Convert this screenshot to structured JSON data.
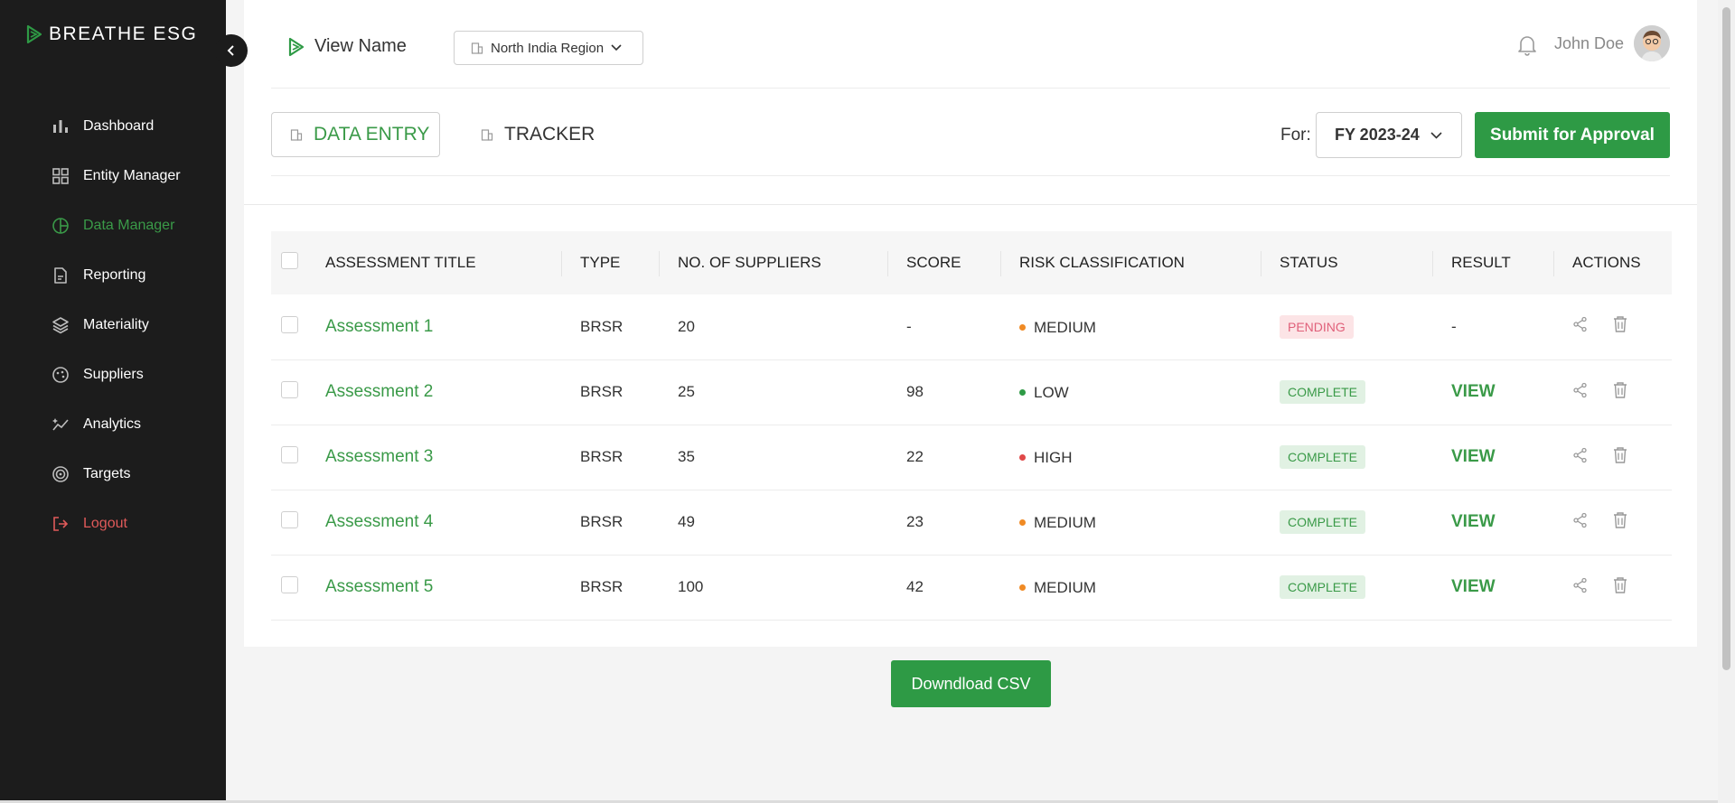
{
  "brand": {
    "name": "BREATHE ESG",
    "accent": "#2e9a45"
  },
  "sidebar": {
    "items": [
      {
        "label": "Dashboard",
        "icon": "bar-chart-icon",
        "active": false
      },
      {
        "label": "Entity Manager",
        "icon": "grid-icon",
        "active": false
      },
      {
        "label": "Data Manager",
        "icon": "pie-chart-icon",
        "active": true
      },
      {
        "label": "Reporting",
        "icon": "document-icon",
        "active": false
      },
      {
        "label": "Materiality",
        "icon": "layers-icon",
        "active": false
      },
      {
        "label": "Suppliers",
        "icon": "palette-icon",
        "active": false
      },
      {
        "label": "Analytics",
        "icon": "sparkle-chart-icon",
        "active": false
      },
      {
        "label": "Targets",
        "icon": "target-icon",
        "active": false
      },
      {
        "label": "Logout",
        "icon": "logout-icon",
        "active": false
      }
    ]
  },
  "header": {
    "view_name": "View Name",
    "region": "North India Region",
    "user_name": "John Doe"
  },
  "tabs": [
    {
      "label": "DATA ENTRY",
      "active": true
    },
    {
      "label": "TRACKER",
      "active": false
    }
  ],
  "filter": {
    "for_label": "For:",
    "fiscal_year": "FY 2023-24",
    "submit_label": "Submit for Approval"
  },
  "table": {
    "columns": [
      "ASSESSMENT TITLE",
      "TYPE",
      "NO. OF SUPPLIERS",
      "SCORE",
      "RISK CLASSIFICATION",
      "STATUS",
      "RESULT",
      "ACTIONS"
    ],
    "rows": [
      {
        "title": "Assessment 1",
        "type": "BRSR",
        "suppliers": "20",
        "score": "-",
        "risk": "MEDIUM",
        "risk_color": "#f08a24",
        "status": "PENDING",
        "status_kind": "pending",
        "result": "-"
      },
      {
        "title": "Assessment 2",
        "type": "BRSR",
        "suppliers": "25",
        "score": "98",
        "risk": "LOW",
        "risk_color": "#2e9a45",
        "status": "COMPLETE",
        "status_kind": "complete",
        "result": "VIEW"
      },
      {
        "title": "Assessment 3",
        "type": "BRSR",
        "suppliers": "35",
        "score": "22",
        "risk": "HIGH",
        "risk_color": "#e04848",
        "status": "COMPLETE",
        "status_kind": "complete",
        "result": "VIEW"
      },
      {
        "title": "Assessment 4",
        "type": "BRSR",
        "suppliers": "49",
        "score": "23",
        "risk": "MEDIUM",
        "risk_color": "#f08a24",
        "status": "COMPLETE",
        "status_kind": "complete",
        "result": "VIEW"
      },
      {
        "title": "Assessment 5",
        "type": "BRSR",
        "suppliers": "100",
        "score": "42",
        "risk": "MEDIUM",
        "risk_color": "#f08a24",
        "status": "COMPLETE",
        "status_kind": "complete",
        "result": "VIEW"
      }
    ]
  },
  "download_label": "Downdload CSV"
}
